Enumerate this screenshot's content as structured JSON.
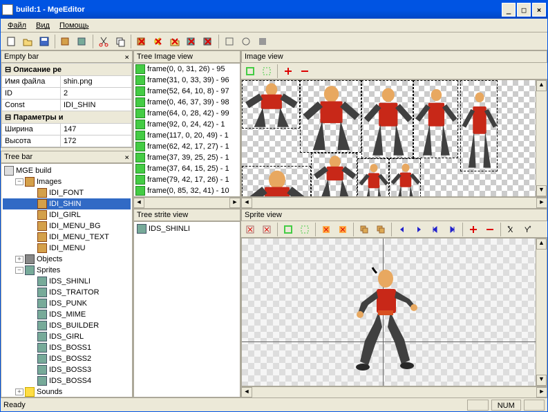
{
  "window": {
    "title": "build:1 - MgeEditor"
  },
  "menu": {
    "file": "Файл",
    "view": "Вид",
    "help": "Помощь"
  },
  "panels": {
    "empty_bar": "Empty bar",
    "tree_bar": "Tree bar",
    "tree_image": "Tree Image view",
    "image_view": "Image view",
    "tree_sprite": "Tree strite view",
    "sprite_view": "Sprite view"
  },
  "properties": {
    "group_desc": "Описание ре",
    "filename_lbl": "Имя файла",
    "filename_val": "shin.png",
    "id_lbl": "ID",
    "id_val": "2",
    "const_lbl": "Const",
    "const_val": "IDI_SHIN",
    "group_params": "Параметры и",
    "width_lbl": "Ширина",
    "width_val": "147",
    "height_lbl": "Высота",
    "height_val": "172"
  },
  "tree": {
    "root": "MGE build",
    "images": "Images",
    "image_items": [
      "IDI_FONT",
      "IDI_SHIN",
      "IDI_GIRL",
      "IDI_MENU_BG",
      "IDI_MENU_TEXT",
      "IDI_MENU"
    ],
    "objects": "Objects",
    "sprites": "Sprites",
    "sprite_items": [
      "IDS_SHINLI",
      "IDS_TRAITOR",
      "IDS_PUNK",
      "IDS_MIME",
      "IDS_BUILDER",
      "IDS_GIRL",
      "IDS_BOSS1",
      "IDS_BOSS2",
      "IDS_BOSS3",
      "IDS_BOSS4"
    ],
    "sounds": "Sounds"
  },
  "frames": [
    "frame(0, 0, 31, 26) - 95",
    "frame(31, 0, 33, 39) - 96",
    "frame(52, 64, 10, 8) - 97",
    "frame(0, 46, 37, 39) - 98",
    "frame(64, 0, 28, 42) - 99",
    "frame(92, 0, 24, 42) - 1",
    "frame(117, 0, 20, 49) - 1",
    "frame(62, 42, 17, 27) - 1",
    "frame(37, 39, 25, 25) - 1",
    "frame(37, 64, 15, 25) - 1",
    "frame(79, 42, 17, 26) - 1",
    "frame(0, 85, 32, 41) - 10"
  ],
  "sprite_tree": {
    "item": "IDS_SHINLI"
  },
  "status": {
    "ready": "Ready",
    "num": "NUM"
  }
}
